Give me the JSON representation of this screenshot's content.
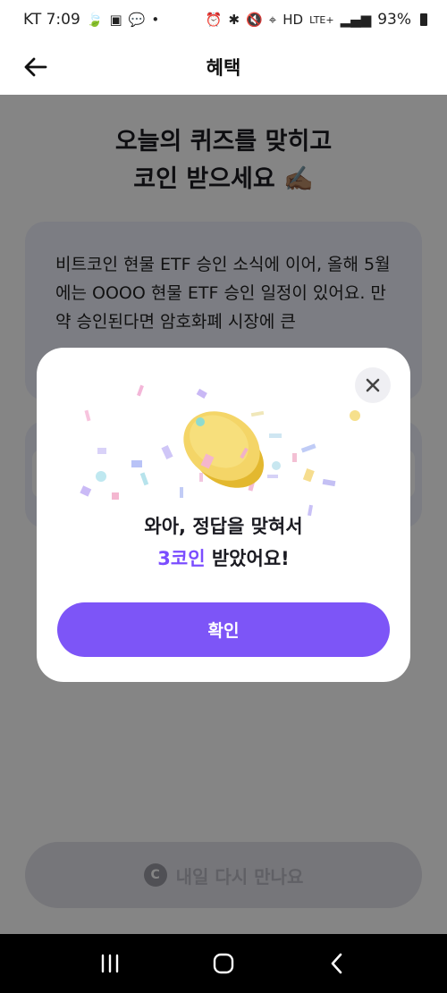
{
  "status_bar": {
    "carrier_time": "KT 7:09",
    "network": "LTE+",
    "battery_pct": "93%"
  },
  "header": {
    "title": "혜택"
  },
  "quiz": {
    "heading_line1": "오늘의 퀴즈를 맞히고",
    "heading_line2": "코인 받으세요 ✍🏽",
    "question_text": "비트코인 현물 ETF 승인 소식에 이어, 올해 5월에는 OOOO 현물 ETF 승인 일정이 있어요. 만약 승인된다면 암호화폐 시장에 큰"
  },
  "bottom_button": {
    "label": "내일 다시 만나요",
    "coin_glyph": "C"
  },
  "modal": {
    "message_line1": "와아, 정답을 맞혀서",
    "reward_amount": "3코인",
    "message_suffix": " 받았어요!",
    "confirm_label": "확인",
    "accent_color": "#7d55f7"
  },
  "icons": {
    "back": "back-arrow-icon",
    "close": "close-icon",
    "coin": "coin-icon"
  }
}
